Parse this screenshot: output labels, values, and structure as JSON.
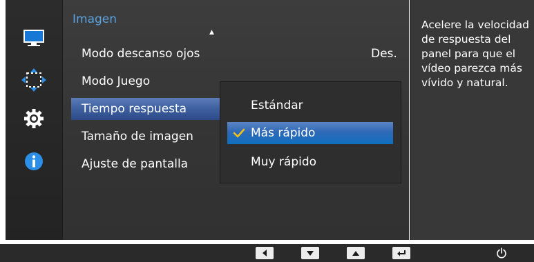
{
  "sidebar": {
    "icons": [
      {
        "name": "monitor-icon"
      },
      {
        "name": "screen-size-icon"
      },
      {
        "name": "gear-icon"
      },
      {
        "name": "info-icon"
      }
    ]
  },
  "menu": {
    "title": "Imagen",
    "items": [
      {
        "label": "Modo descanso ojos",
        "value": "Des."
      },
      {
        "label": "Modo Juego"
      },
      {
        "label": "Tiempo respuesta",
        "selected": true
      },
      {
        "label": "Tamaño de imagen"
      },
      {
        "label": "Ajuste de pantalla"
      }
    ]
  },
  "submenu": {
    "items": [
      {
        "label": "Estándar"
      },
      {
        "label": "Más rápido",
        "selected": true,
        "checked": true
      },
      {
        "label": "Muy rápido"
      }
    ]
  },
  "help": {
    "text": "Acelere la velocidad de respuesta del panel para que el vídeo parezca más vívido y natural."
  },
  "controls": [
    "left-arrow-icon",
    "down-arrow-icon",
    "up-arrow-icon",
    "enter-icon",
    "power-icon"
  ],
  "colors": {
    "title_blue": "#5aa3e0",
    "selection_blue": "#2f69b6",
    "check_yellow": "#f3c21a"
  }
}
